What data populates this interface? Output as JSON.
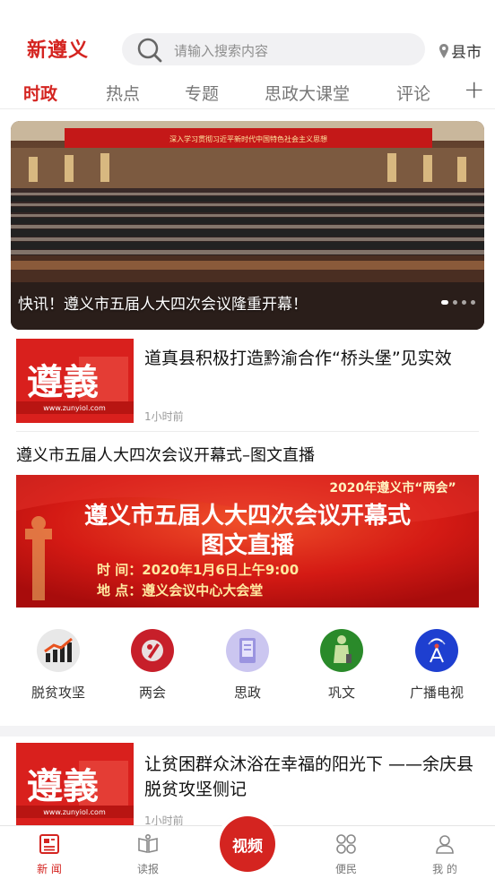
{
  "header": {
    "logo": "新遵义",
    "search_placeholder": "请输入搜索内容",
    "city_label": "县市"
  },
  "tabs": [
    {
      "label": "时政",
      "active": true
    },
    {
      "label": "热点"
    },
    {
      "label": "专题"
    },
    {
      "label": "思政大课堂"
    },
    {
      "label": "评论"
    }
  ],
  "banner": {
    "caption": "快讯！遵义市五届人大四次会议隆重开幕！",
    "hall_banner_text": "深入学习贯彻习近平新时代中国特色社会主义思想"
  },
  "news": [
    {
      "title": "道真县积极打造黔渝合作“桥头堡”见实效",
      "time": "1小时前",
      "thumb_text": "遵義",
      "thumb_url": "www.zunyiol.com"
    },
    {
      "title": "让贫困群众沐浴在幸福的阳光下 ——余庆县脱贫攻坚侧记",
      "time": "1小时前",
      "thumb_text": "遵義",
      "thumb_url": "www.zunyiol.com"
    }
  ],
  "live": {
    "title": "遵义市五届人大四次会议开幕式–图文直播",
    "banner_top": "2020年遵义市“两会”",
    "banner_line1": "遵义市五届人大四次会议开幕式",
    "banner_line2": "图文直播",
    "time_line": "时 间：2020年1月6日上午9:00",
    "place_line": "地 点：遵义会议中心大会堂"
  },
  "categories": [
    {
      "label": "脱贫攻坚",
      "icon": "chart-icon",
      "color": "#e6e6e6"
    },
    {
      "label": "两会",
      "icon": "pen-icon",
      "color": "#c71f2a"
    },
    {
      "label": "思政",
      "icon": "book-icon",
      "color": "#c9c4ef"
    },
    {
      "label": "巩文",
      "icon": "person-icon",
      "color": "#2a8a2a"
    },
    {
      "label": "广播电视",
      "icon": "antenna-icon",
      "color": "#1e3fd0"
    }
  ],
  "bottom_nav": {
    "news": "新 闻",
    "read": "读报",
    "video": "视频",
    "service": "便民",
    "mine": "我 的"
  },
  "colors": {
    "accent": "#d42420"
  }
}
